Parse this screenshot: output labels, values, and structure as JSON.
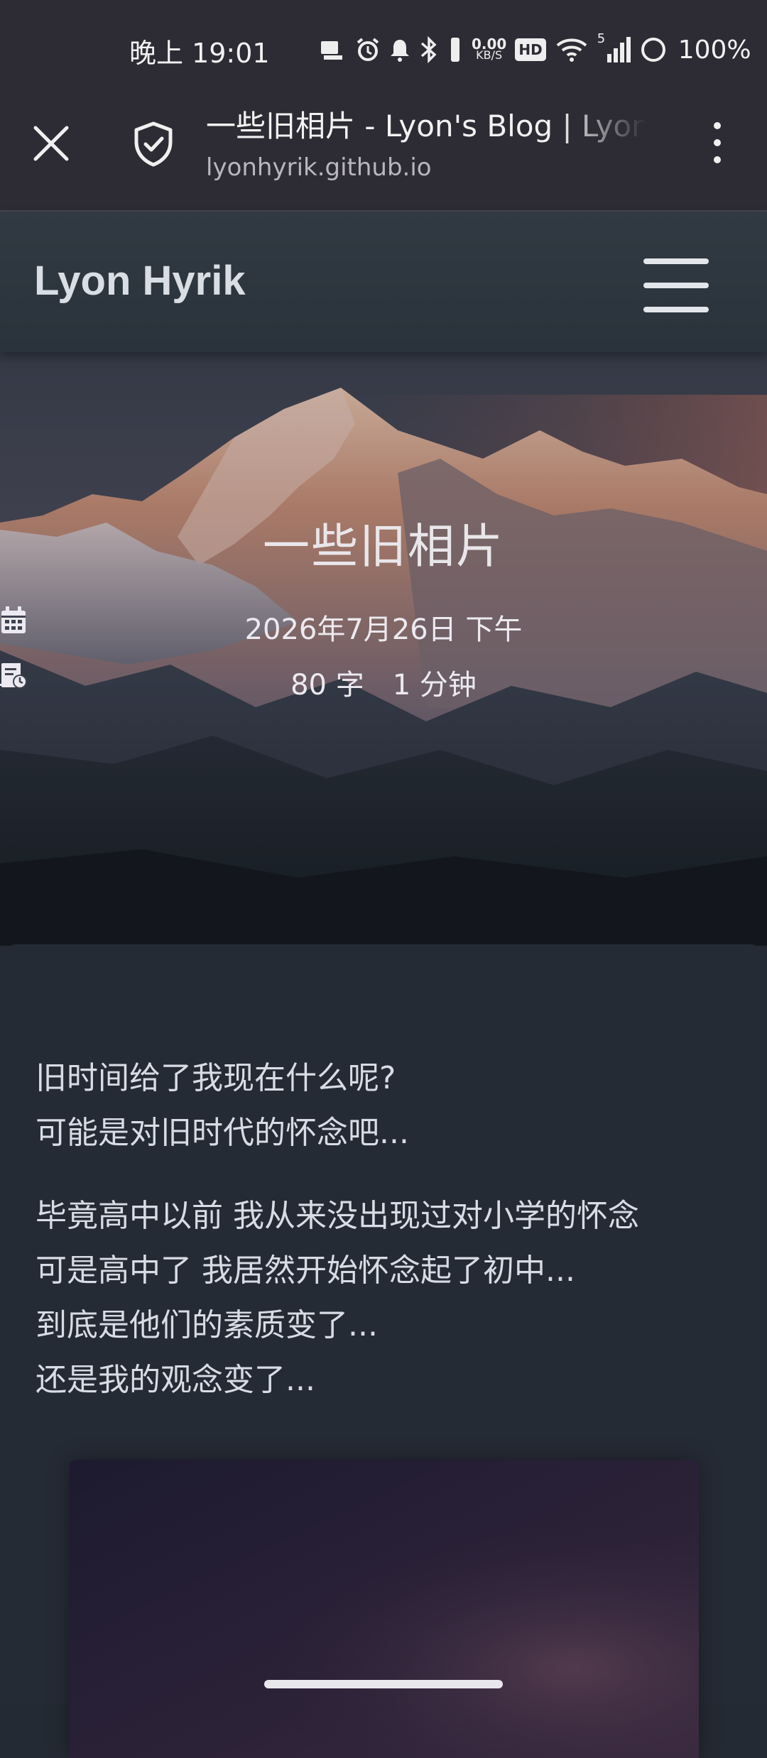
{
  "status_bar": {
    "time": "晚上 19:01",
    "net_speed_value": "0.00",
    "net_speed_unit": "KB/S",
    "hd_badge": "HD",
    "signal_sup": "5",
    "battery": "100%"
  },
  "browser": {
    "page_title": "一些旧相片 - Lyon's Blog | Lyon",
    "url": "lyonhyrik.github.io"
  },
  "site": {
    "title": "Lyon Hyrik"
  },
  "post": {
    "title": "一些旧相片",
    "date": "2026年7月26日 下午",
    "word_count": "80 字",
    "read_time": "1 分钟"
  },
  "content": {
    "paragraph1": [
      "旧时间给了我现在什么呢?",
      "可能是对旧时代的怀念吧..."
    ],
    "paragraph2": [
      "毕竟高中以前 我从来没出现过对小学的怀念",
      "可是高中了 我居然开始怀念起了初中...",
      "到底是他们的素质变了...",
      "还是我的观念变了..."
    ]
  },
  "icons": {
    "close": "close-icon",
    "shield": "shield-check-icon",
    "menu": "more-vert-icon",
    "hamburger": "hamburger-icon",
    "calendar": "calendar-icon",
    "chart": "bar-chart-icon",
    "read": "document-clock-icon"
  },
  "colors": {
    "status_bg": "#2d2b33",
    "nav_bg": "#313942",
    "card_bg": "#252b35",
    "text": "#d8dde5"
  }
}
